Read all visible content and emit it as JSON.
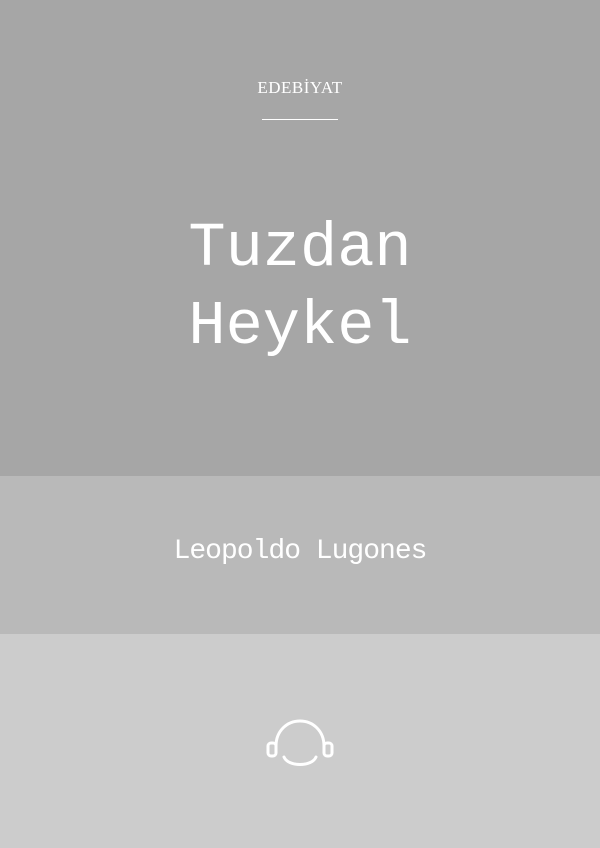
{
  "cover": {
    "category": "EDEBİYAT",
    "title_line_1": "Tuzdan",
    "title_line_2": "Heykel",
    "author": "Leopoldo Lugones",
    "icon": "headphones-icon"
  },
  "colors": {
    "top_band": "#a6a6a6",
    "middle_band": "#b9b9b9",
    "bottom_band": "#cccccc",
    "text": "#ffffff"
  }
}
